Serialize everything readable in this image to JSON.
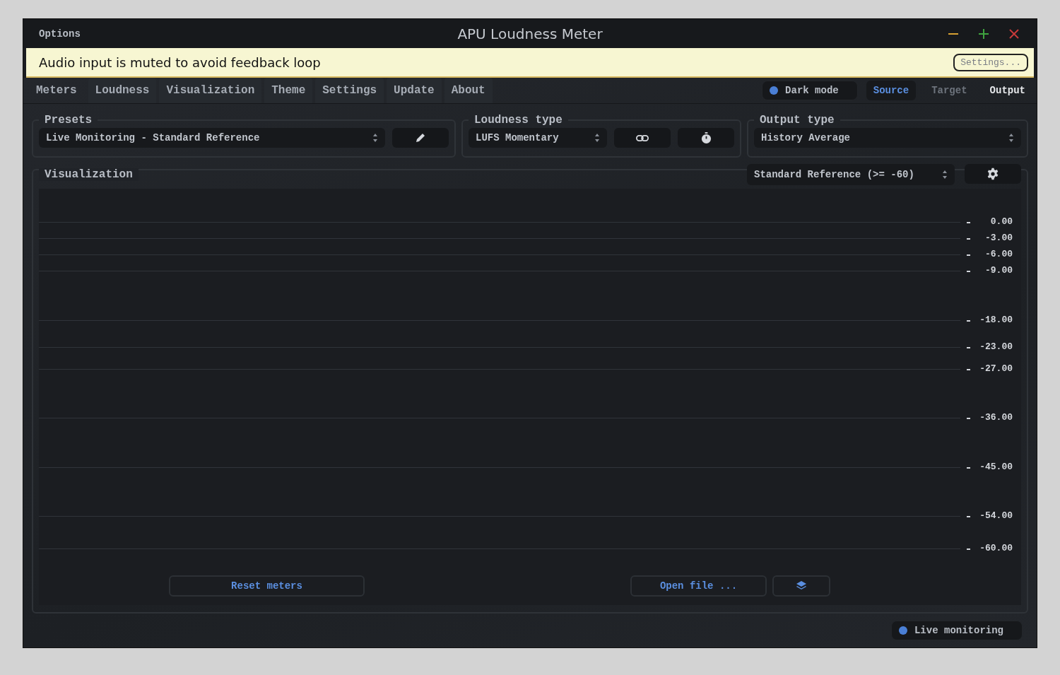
{
  "window": {
    "menu": "Options",
    "title": "APU Loudness Meter"
  },
  "notice": {
    "message": "Audio input is muted to avoid feedback loop",
    "button": "Settings..."
  },
  "tabs": [
    {
      "label": "Meters",
      "selected": true
    },
    {
      "label": "Loudness",
      "selected": false
    },
    {
      "label": "Visualization",
      "selected": false
    },
    {
      "label": "Theme",
      "selected": false
    },
    {
      "label": "Settings",
      "selected": false
    },
    {
      "label": "Update",
      "selected": false
    },
    {
      "label": "About",
      "selected": false
    }
  ],
  "dark_mode": {
    "label": "Dark mode",
    "on": true
  },
  "views": [
    {
      "label": "Source",
      "selected": true,
      "disabled": false
    },
    {
      "label": "Target",
      "selected": false,
      "disabled": true
    },
    {
      "label": "Output",
      "selected": false,
      "disabled": false
    }
  ],
  "presets": {
    "title": "Presets",
    "value": "Live Monitoring - Standard Reference"
  },
  "loudness_type": {
    "title": "Loudness type",
    "value": "LUFS Momentary"
  },
  "output_type": {
    "title": "Output type",
    "value": "History Average"
  },
  "visualization": {
    "title": "Visualization",
    "range": "Standard Reference (>= -60)",
    "scale": [
      "0.00",
      "-3.00",
      "-6.00",
      "-9.00",
      "-18.00",
      "-23.00",
      "-27.00",
      "-36.00",
      "-45.00",
      "-54.00",
      "-60.00"
    ],
    "reset_button": "Reset meters",
    "open_button": "Open file ..."
  },
  "live_monitoring": {
    "label": "Live monitoring",
    "on": true
  }
}
